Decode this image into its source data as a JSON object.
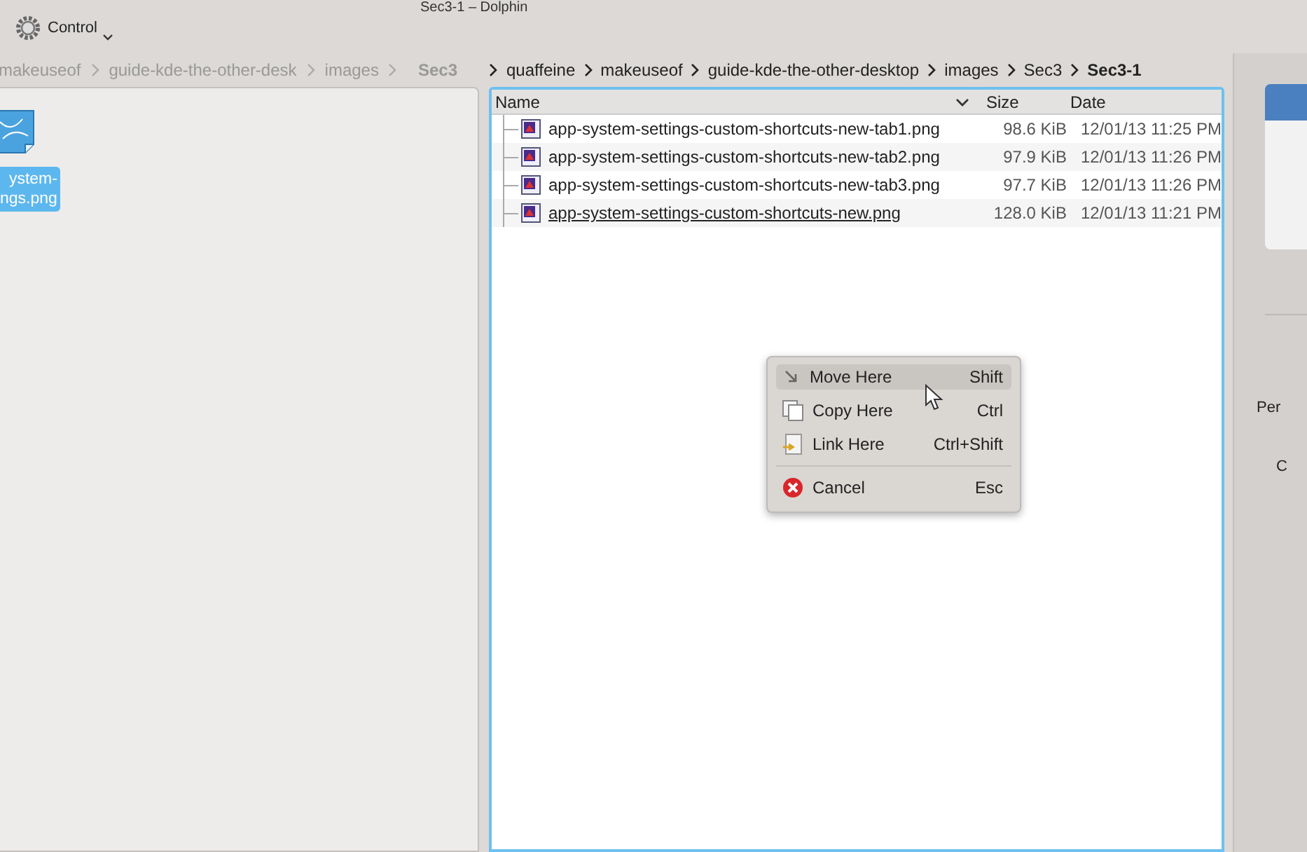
{
  "window": {
    "title": "Sec3-1 – Dolphin"
  },
  "toolbar": {
    "control_label": "Control"
  },
  "left_pane": {
    "breadcrumb": [
      {
        "label": "makeuseof",
        "current": false
      },
      {
        "label": "guide-kde-the-other-desk",
        "current": false
      },
      {
        "label": "images",
        "current": false
      },
      {
        "label": "Sec3",
        "current": true
      }
    ],
    "icon_item": {
      "label_line_1": "ystem-",
      "label_line_2": "ngs.png",
      "selected": true
    }
  },
  "right_pane": {
    "breadcrumb": [
      {
        "label": "quaffeine",
        "current": false
      },
      {
        "label": "makeuseof",
        "current": false
      },
      {
        "label": "guide-kde-the-other-desktop",
        "current": false
      },
      {
        "label": "images",
        "current": false
      },
      {
        "label": "Sec3",
        "current": false
      },
      {
        "label": "Sec3-1",
        "current": true
      }
    ],
    "table": {
      "columns": [
        "Name",
        "Size",
        "Date"
      ],
      "rows": [
        {
          "name": "app-system-settings-custom-shortcuts-new-tab1.png",
          "size": "98.6 KiB",
          "date": "12/01/13 11:25 PM",
          "hovered": false
        },
        {
          "name": "app-system-settings-custom-shortcuts-new-tab2.png",
          "size": "97.9 KiB",
          "date": "12/01/13 11:26 PM",
          "hovered": false
        },
        {
          "name": "app-system-settings-custom-shortcuts-new-tab3.png",
          "size": "97.7 KiB",
          "date": "12/01/13 11:26 PM",
          "hovered": false
        },
        {
          "name": "app-system-settings-custom-shortcuts-new.png",
          "size": "128.0 KiB",
          "date": "12/01/13 11:21 PM",
          "hovered": true
        }
      ]
    }
  },
  "context_menu": {
    "items": [
      {
        "kind": "move",
        "label": "Move Here",
        "shortcut": "Shift",
        "selected": true
      },
      {
        "kind": "copy",
        "label": "Copy Here",
        "shortcut": "Ctrl",
        "selected": false
      },
      {
        "kind": "link",
        "label": "Link Here",
        "shortcut": "Ctrl+Shift",
        "selected": false
      },
      {
        "kind": "cancel",
        "label": "Cancel",
        "shortcut": "Esc",
        "selected": false
      }
    ]
  },
  "info_panel": {
    "texts": [
      "Per",
      "C"
    ]
  }
}
